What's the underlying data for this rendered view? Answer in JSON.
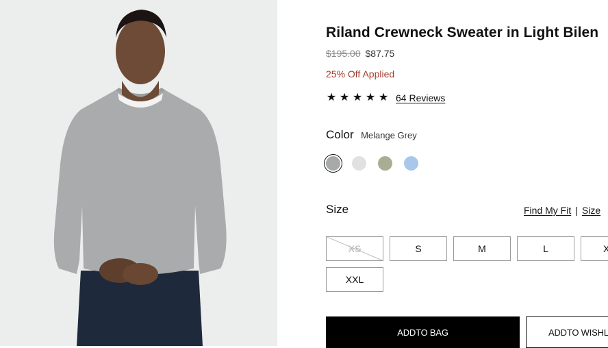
{
  "product": {
    "title": "Riland Crewneck Sweater in Light Bilen",
    "price_original": "$195.00",
    "price_sale": "$87.75",
    "discount_text": "25% Off Applied",
    "rating_stars": 5,
    "reviews_link": "64 Reviews"
  },
  "color": {
    "label": "Color",
    "selected_name": "Melange Grey",
    "swatches": [
      {
        "name": "melange-grey",
        "hex": "#a7a9ab",
        "selected": true
      },
      {
        "name": "light-grey",
        "hex": "#e1e1e1",
        "selected": false
      },
      {
        "name": "sage",
        "hex": "#a7ae92",
        "selected": false
      },
      {
        "name": "light-blue",
        "hex": "#a7c8ea",
        "selected": false
      }
    ]
  },
  "size": {
    "label": "Size",
    "find_fit_link": "Find My Fit",
    "separator": "|",
    "size_guide_link": "Size",
    "options": [
      {
        "label": "XS",
        "available": false
      },
      {
        "label": "S",
        "available": true
      },
      {
        "label": "M",
        "available": true
      },
      {
        "label": "L",
        "available": true
      },
      {
        "label": "X",
        "available": true
      },
      {
        "label": "XXL",
        "available": true
      }
    ]
  },
  "actions": {
    "add_to_bag": "ADDTO BAG",
    "add_to_wishlist": "ADDTO WISHLIS"
  }
}
